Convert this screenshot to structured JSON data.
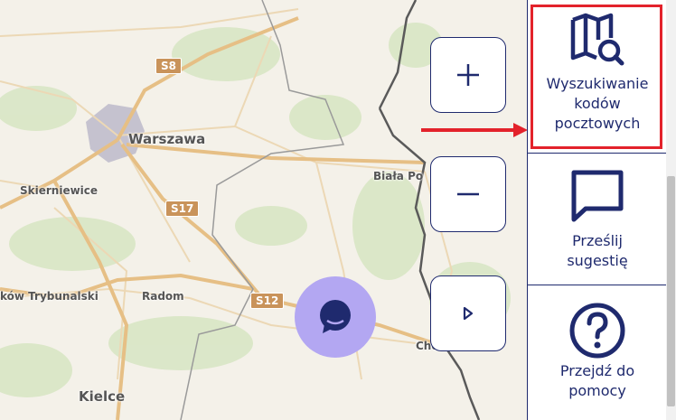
{
  "map": {
    "cities": [
      {
        "id": "warszawa",
        "label": "Warszawa"
      },
      {
        "id": "skierniewice",
        "label": "Skierniewice"
      },
      {
        "id": "biala",
        "label": "Biała Po"
      },
      {
        "id": "trybunalski",
        "label": "ków Trybunalski"
      },
      {
        "id": "radom",
        "label": "Radom"
      },
      {
        "id": "chelm",
        "label": "Chełm"
      },
      {
        "id": "kielce",
        "label": "Kielce"
      }
    ],
    "roads": [
      {
        "id": "s8",
        "label": "S8"
      },
      {
        "id": "s17",
        "label": "S17"
      },
      {
        "id": "s12",
        "label": "S12"
      }
    ],
    "colors": {
      "background": "#f4f1e9",
      "road": "#e8c89a",
      "border": "#555555",
      "forest": "#cfe0b8"
    }
  },
  "controls": {
    "zoom_in": {
      "icon": "plus-icon"
    },
    "zoom_out": {
      "icon": "minus-icon"
    },
    "expand": {
      "icon": "caret-right-icon"
    }
  },
  "chat": {
    "icon": "chat-bubble-icon",
    "color": "#b3a7f2"
  },
  "panel": {
    "items": [
      {
        "id": "postal",
        "label": "Wyszukiwanie kodów pocztowych",
        "lines": [
          "Wyszukiwanie",
          "kodów",
          "pocztowych"
        ],
        "icon": "map-search-icon"
      },
      {
        "id": "suggest",
        "label": "Prześlij sugestię",
        "lines": [
          "Prześlij",
          "sugestię"
        ],
        "icon": "speech-bubble-icon"
      },
      {
        "id": "help",
        "label": "Przejdź do pomocy",
        "lines": [
          "Przejdź do",
          "pomocy"
        ],
        "icon": "question-circle-icon"
      }
    ],
    "accent": "#1f2a6e",
    "highlight_color": "#e3222b"
  }
}
